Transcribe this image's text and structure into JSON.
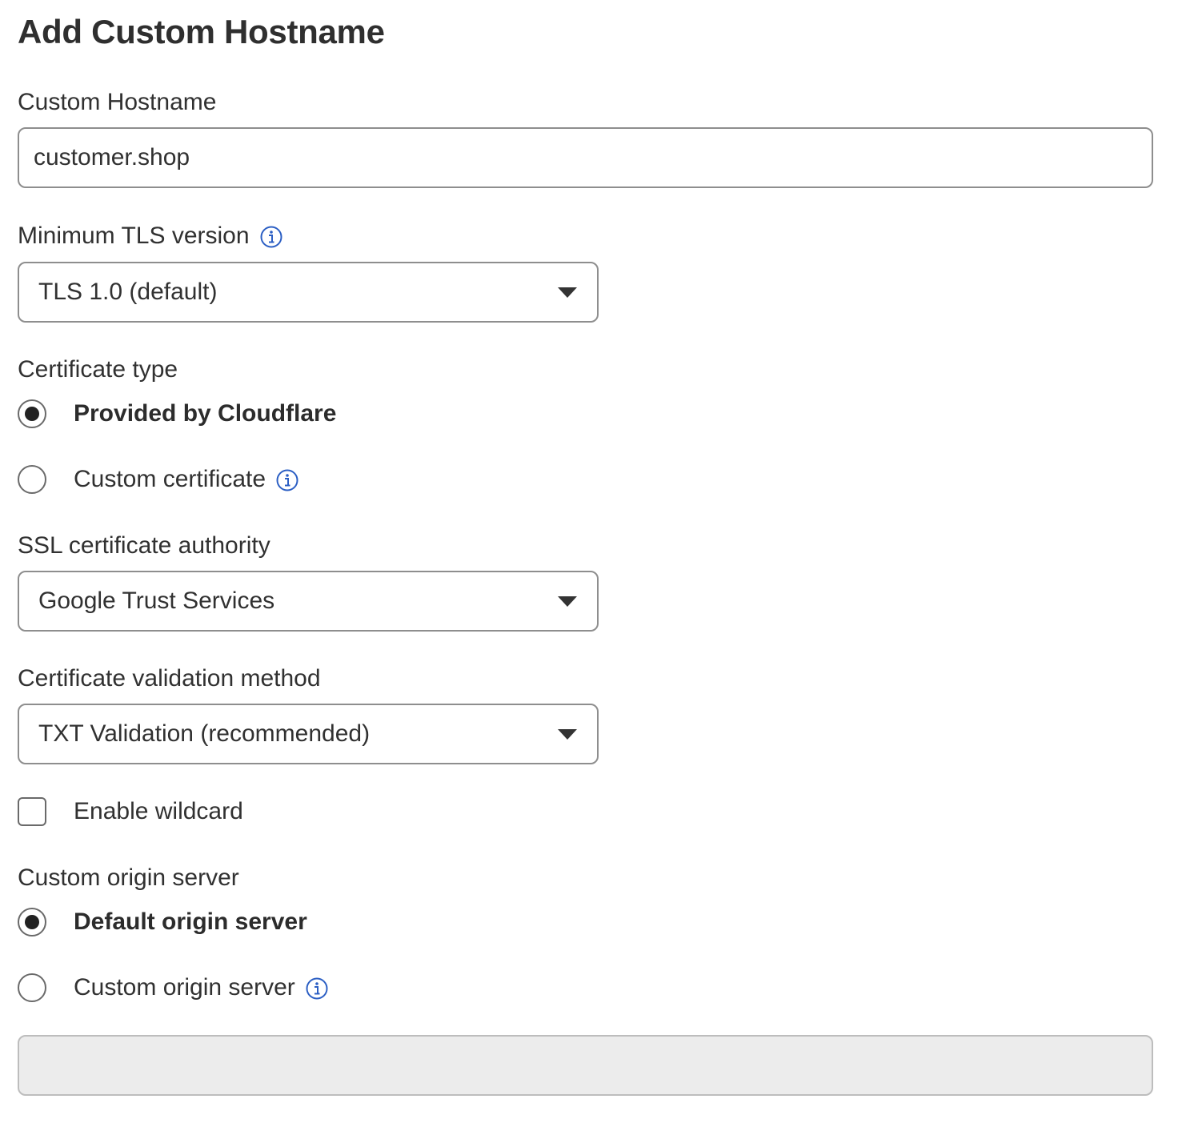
{
  "page": {
    "title": "Add Custom Hostname"
  },
  "hostname": {
    "label": "Custom Hostname",
    "value": "customer.shop"
  },
  "tls": {
    "label": "Minimum TLS version",
    "selected": "TLS 1.0 (default)",
    "info_icon": "info-icon"
  },
  "certificate_type": {
    "label": "Certificate type",
    "options": [
      {
        "label": "Provided by Cloudflare",
        "checked": true
      },
      {
        "label": "Custom certificate",
        "checked": false,
        "info_icon": "info-icon"
      }
    ]
  },
  "ssl_authority": {
    "label": "SSL certificate authority",
    "selected": "Google Trust Services"
  },
  "validation": {
    "label": "Certificate validation method",
    "selected": "TXT Validation (recommended)"
  },
  "wildcard": {
    "label": "Enable wildcard",
    "checked": false
  },
  "origin": {
    "label": "Custom origin server",
    "options": [
      {
        "label": "Default origin server",
        "checked": true
      },
      {
        "label": "Custom origin server",
        "checked": false,
        "info_icon": "info-icon"
      }
    ],
    "input_value": ""
  },
  "colors": {
    "info_icon": "#2c5fc4",
    "border": "#8e8e8e",
    "disabled_bg": "#ececec",
    "text": "#313131"
  }
}
